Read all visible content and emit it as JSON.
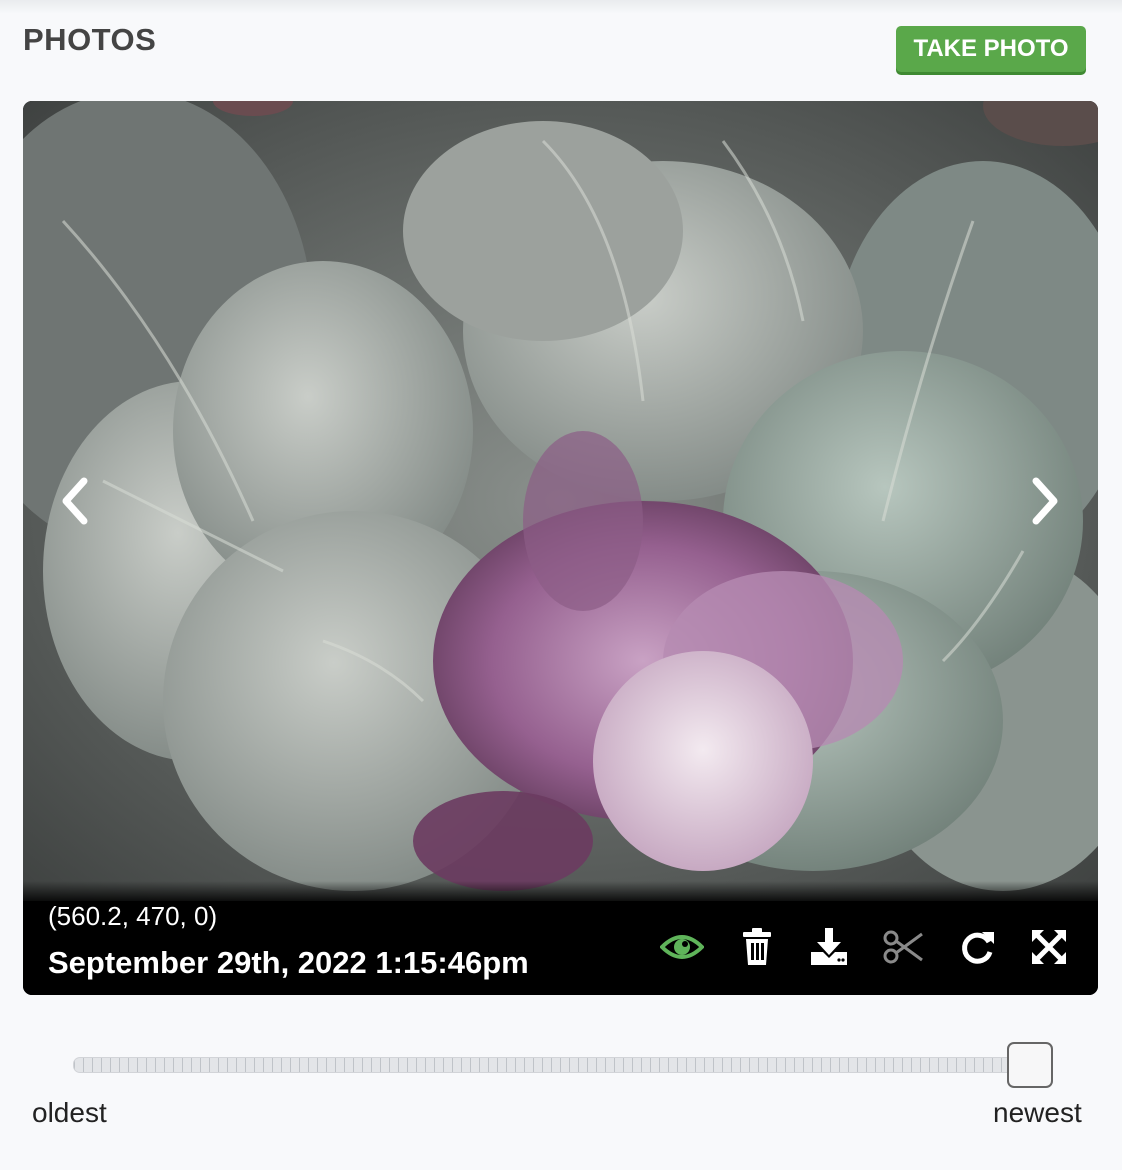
{
  "header": {
    "title": "PHOTOS",
    "take_photo_label": "TAKE PHOTO"
  },
  "photo": {
    "coordinates": "(560.2, 470, 0)",
    "timestamp": "September 29th, 2022 1:15:46pm"
  },
  "toolbar": {
    "icons": [
      "eye-icon",
      "trash-icon",
      "download-icon",
      "scissors-icon",
      "refresh-icon",
      "expand-icon"
    ]
  },
  "timeline": {
    "oldest_label": "oldest",
    "newest_label": "newest",
    "position": 1.0
  },
  "colors": {
    "accent_green": "#5aa84a",
    "eye_icon": "#5fb45a",
    "disabled_icon": "#8a8a8a"
  }
}
